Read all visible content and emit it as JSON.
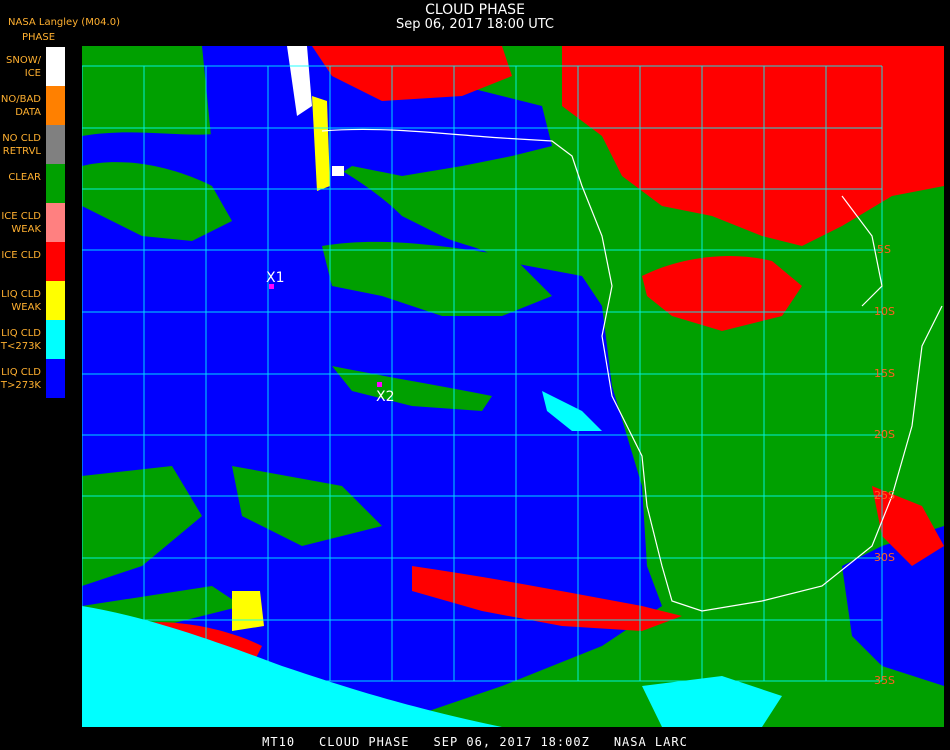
{
  "header": {
    "org": "NASA Langley (M04.0)",
    "title": "CLOUD PHASE",
    "subtitle": "Sep 06, 2017 18:00 UTC"
  },
  "legend": {
    "title": "PHASE",
    "items": [
      {
        "label": "SNOW/\nICE",
        "color": "#ffffff"
      },
      {
        "label": "NO/BAD\nDATA",
        "color": "#ff8000"
      },
      {
        "label": "NO CLD\nRETRVL",
        "color": "#808080"
      },
      {
        "label": "CLEAR",
        "color": "#00a000"
      },
      {
        "label": "ICE CLD\nWEAK",
        "color": "#ff8080"
      },
      {
        "label": "ICE CLD",
        "color": "#ff0000"
      },
      {
        "label": "LIQ CLD\nWEAK",
        "color": "#ffff00"
      },
      {
        "label": "LIQ CLD\nT<273K",
        "color": "#00ffff"
      },
      {
        "label": "LIQ CLD\nT>273K",
        "color": "#0000ff"
      }
    ]
  },
  "map": {
    "markers": [
      {
        "label": "X1"
      },
      {
        "label": "X2"
      }
    ],
    "lat_labels": [
      "5S",
      "10S",
      "15S",
      "20S",
      "25S",
      "30S",
      "35S"
    ],
    "grid_color": "#00ffff",
    "coast_color": "#ffffff",
    "marker_color": "#ff00ff"
  },
  "footer": {
    "product": "MT10",
    "name": "CLOUD PHASE",
    "date": "SEP 06, 2017 18:00Z",
    "source": "NASA LARC"
  }
}
